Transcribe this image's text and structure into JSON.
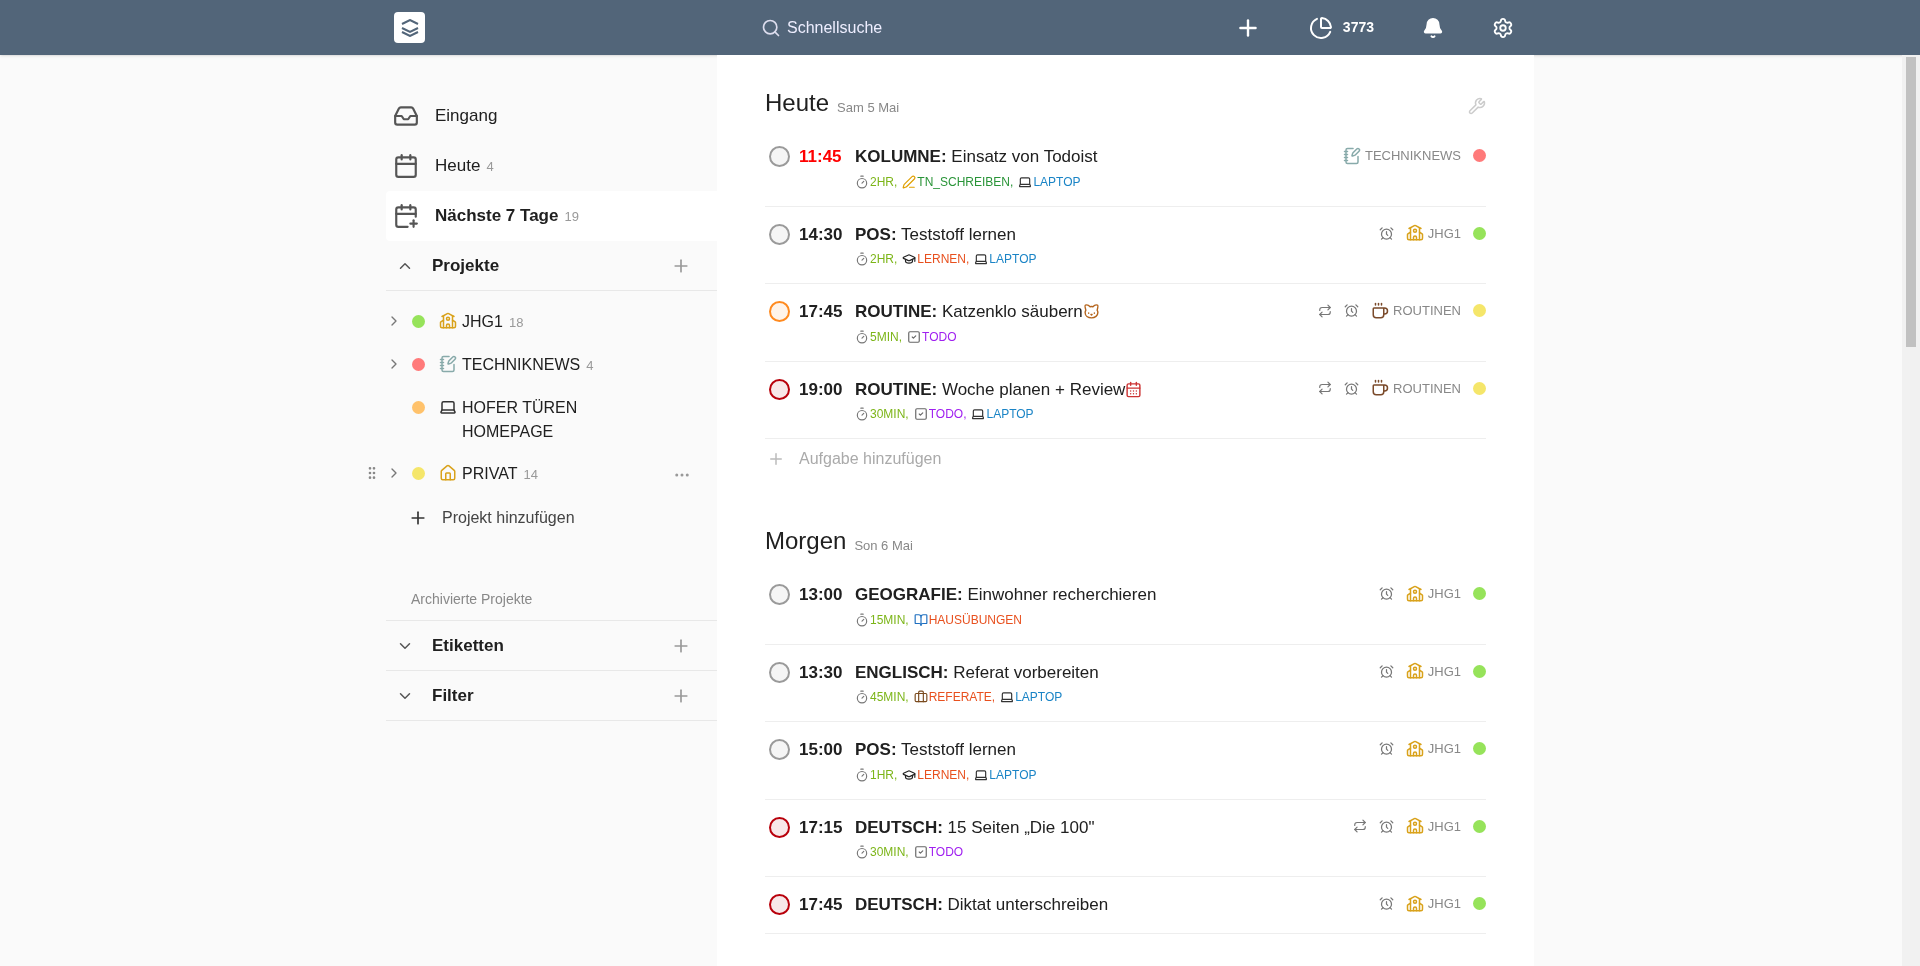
{
  "top_bar": {
    "search": {
      "placeholder": "Schnellsuche"
    },
    "karma": "3773"
  },
  "sidebar": {
    "nav": [
      {
        "label": "Eingang",
        "kind": "inbox",
        "selected": false
      },
      {
        "label": "Heute",
        "count": "4",
        "kind": "today",
        "selected": false
      },
      {
        "label": "Nächste 7 Tage",
        "count": "19",
        "kind": "week",
        "selected": true
      }
    ],
    "projects": {
      "title": "Projekte",
      "expanded": true,
      "items": [
        {
          "name": "JHG1",
          "count": "18",
          "kind": "school",
          "color": "#96e35a",
          "has_children": true,
          "hovered": false
        },
        {
          "name": "TECHNIKNEWS",
          "count": "4",
          "kind": "notes",
          "color": "#ff7a7a",
          "has_children": true,
          "hovered": false
        },
        {
          "name": "HOFER TÜREN HOMEPAGE",
          "kind": "laptop",
          "color": "#ffc26b",
          "has_children": false,
          "hovered": false
        },
        {
          "name": "PRIVAT",
          "count": "14",
          "kind": "house",
          "color": "#f5e66a",
          "has_children": true,
          "hovered": true
        }
      ],
      "add": "Projekt hinzufügen",
      "archived": "Archivierte Projekte"
    },
    "sections": [
      {
        "title": "Etiketten",
        "expanded": false
      },
      {
        "title": "Filter",
        "expanded": false
      }
    ]
  },
  "days": [
    {
      "title": "Heute",
      "date": "Sam 5 Mai",
      "add_task": "Aufgabe hinzufügen",
      "tasks": [
        {
          "time": "11:45",
          "overdue": true,
          "color": "#9a9a9a",
          "title": "**KOLUMNE:** Einsatz von Todoist",
          "recurring": false,
          "reminder": false,
          "project": {
            "name": "TECHNIKNEWS",
            "kind": "notes",
            "color": "#ff7a7a"
          },
          "labels": [
            {
              "text": "2HR,",
              "kind": "timer",
              "color": "#7cb518"
            },
            {
              "text": "TN_SCHREIBEN,",
              "kind": "writing",
              "color": "#299438"
            },
            {
              "text": "LAPTOP",
              "kind": "laptop",
              "color": "#1a84c6"
            }
          ]
        },
        {
          "time": "14:30",
          "overdue": false,
          "color": "#9a9a9a",
          "title": "**POS:** Teststoff lernen",
          "recurring": false,
          "reminder": true,
          "project": {
            "name": "JHG1",
            "kind": "school",
            "color": "#96e35a"
          },
          "labels": [
            {
              "text": "2HR,",
              "kind": "timer",
              "color": "#7cb518"
            },
            {
              "text": "LERNEN,",
              "kind": "learning",
              "color": "#e8501e"
            },
            {
              "text": "LAPTOP",
              "kind": "laptop",
              "color": "#1a84c6"
            }
          ]
        },
        {
          "time": "17:45",
          "overdue": false,
          "color": "#ff8a1f",
          "title": "**ROUTINE:** Katzenklo säubern",
          "title_icon": {
            "kind": "cat"
          },
          "recurring": true,
          "reminder": true,
          "project": {
            "name": "ROUTINEN",
            "kind": "coffee",
            "color": "#f5e66a"
          },
          "labels": [
            {
              "text": "5MIN,",
              "kind": "timer",
              "color": "#7cb518"
            },
            {
              "text": "TODO",
              "kind": "todo",
              "color": "#a020f0"
            }
          ]
        },
        {
          "time": "19:00",
          "overdue": false,
          "color": "#b8000b",
          "title": "**ROUTINE:** Woche planen + Review",
          "title_icon": {
            "kind": "calendar"
          },
          "recurring": true,
          "reminder": true,
          "project": {
            "name": "ROUTINEN",
            "kind": "coffee",
            "color": "#f5e66a"
          },
          "labels": [
            {
              "text": "30MIN,",
              "kind": "timer",
              "color": "#7cb518"
            },
            {
              "text": "TODO,",
              "kind": "todo",
              "color": "#a020f0"
            },
            {
              "text": "LAPTOP",
              "kind": "laptop",
              "color": "#1a84c6"
            }
          ]
        }
      ]
    },
    {
      "title": "Morgen",
      "date": "Son 6 Mai",
      "tasks": [
        {
          "time": "13:00",
          "overdue": false,
          "color": "#9a9a9a",
          "title": "**GEOGRAFIE:** Einwohner recherchieren",
          "recurring": false,
          "reminder": true,
          "project": {
            "name": "JHG1",
            "kind": "school",
            "color": "#96e35a"
          },
          "labels": [
            {
              "text": "15MIN,",
              "kind": "timer",
              "color": "#7cb518"
            },
            {
              "text": "HAUSÜBUNGEN",
              "kind": "homework",
              "color": "#e8501e"
            }
          ]
        },
        {
          "time": "13:30",
          "overdue": false,
          "color": "#9a9a9a",
          "title": "**ENGLISCH:** Referat vorbereiten",
          "recurring": false,
          "reminder": true,
          "project": {
            "name": "JHG1",
            "kind": "school",
            "color": "#96e35a"
          },
          "labels": [
            {
              "text": "45MIN,",
              "kind": "timer",
              "color": "#7cb518"
            },
            {
              "text": "REFERATE,",
              "kind": "presentation",
              "color": "#e8501e"
            },
            {
              "text": "LAPTOP",
              "kind": "laptop",
              "color": "#1a84c6"
            }
          ]
        },
        {
          "time": "15:00",
          "overdue": false,
          "color": "#9a9a9a",
          "title": "**POS:** Teststoff lernen",
          "recurring": false,
          "reminder": true,
          "project": {
            "name": "JHG1",
            "kind": "school",
            "color": "#96e35a"
          },
          "labels": [
            {
              "text": "1HR,",
              "kind": "timer",
              "color": "#7cb518"
            },
            {
              "text": "LERNEN,",
              "kind": "learning",
              "color": "#e8501e"
            },
            {
              "text": "LAPTOP",
              "kind": "laptop",
              "color": "#1a84c6"
            }
          ]
        },
        {
          "time": "17:15",
          "overdue": false,
          "color": "#b8000b",
          "title": "**DEUTSCH:** 15 Seiten „Die 100\"",
          "recurring": true,
          "reminder": true,
          "project": {
            "name": "JHG1",
            "kind": "school",
            "color": "#96e35a"
          },
          "labels": [
            {
              "text": "30MIN,",
              "kind": "timer",
              "color": "#7cb518"
            },
            {
              "text": "TODO",
              "kind": "todo",
              "color": "#a020f0"
            }
          ]
        },
        {
          "time": "17:45",
          "overdue": false,
          "color": "#b8000b",
          "title": "**DEUTSCH:** Diktat unterschreiben",
          "recurring": false,
          "reminder": true,
          "project": {
            "name": "JHG1",
            "kind": "school",
            "color": "#96e35a"
          }
        }
      ]
    }
  ]
}
